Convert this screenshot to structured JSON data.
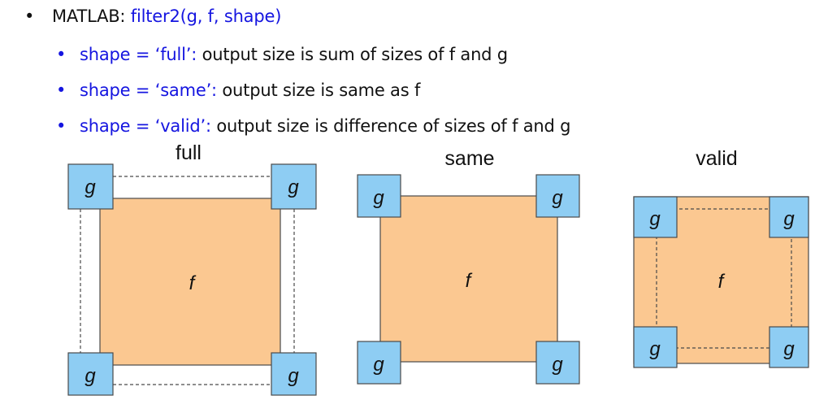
{
  "bullets": {
    "main": {
      "marker": "•",
      "label": "MATLAB: ",
      "code": "filter2(g, f, shape)"
    },
    "subs": [
      {
        "marker": "•",
        "option": "shape = ‘full’:",
        "description": " output size is sum of sizes of f and g"
      },
      {
        "marker": "•",
        "option": "shape = ‘same’:",
        "description": " output size is same as f"
      },
      {
        "marker": "•",
        "option": "shape = ‘valid’:",
        "description": " output size is difference of sizes of f and g"
      }
    ]
  },
  "panels": [
    {
      "id": "full",
      "title": "full",
      "kernel_label": "g",
      "image_label": "f"
    },
    {
      "id": "same",
      "title": "same",
      "kernel_label": "g",
      "image_label": "f"
    },
    {
      "id": "valid",
      "title": "valid",
      "kernel_label": "g",
      "image_label": "f"
    }
  ],
  "colors": {
    "image_fill": "#fbc891",
    "kernel_fill": "#8ecdf3",
    "code_text": "#1515e0",
    "outline": "#4a4a4a"
  }
}
